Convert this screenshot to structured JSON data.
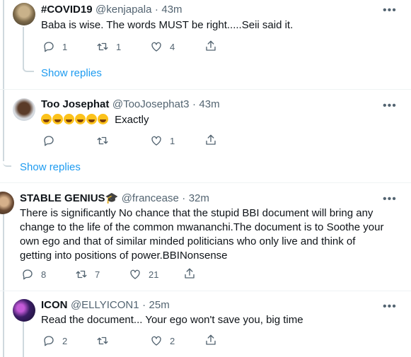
{
  "tweets": [
    {
      "name": "#COVID19",
      "handle": "@kenjapala",
      "time": "43m",
      "text": "Baba is wise. The words MUST be right.....Seii said it.",
      "replies": "1",
      "retweets": "1",
      "likes": "4",
      "show_replies": "Show replies"
    },
    {
      "name": "Too Josephat",
      "handle": "@TooJosephat3",
      "time": "43m",
      "emoji": "🤣🤣🤣🤣🤣🤣",
      "text": "Exactly",
      "replies": "",
      "retweets": "",
      "likes": "1"
    },
    {
      "show_replies": "Show replies"
    },
    {
      "name": "STABLE GENIUS🎓",
      "handle": "@francease",
      "time": "32m",
      "text_lines": [
        "There is significantly No chance that the stupid BBI document will bring any",
        "change to the life of the common mwananchi.The document is to Soothe your",
        "own ego and that of similar minded politicians who only live and think of",
        "getting into positions of power.BBINonsense"
      ],
      "replies": "8",
      "retweets": "7",
      "likes": "21"
    },
    {
      "name": "ICON",
      "handle": "@ELLYICON1",
      "time": "25m",
      "text": "Read the document... Your ego won't save you, big time",
      "replies": "2",
      "retweets": "",
      "likes": "2"
    }
  ],
  "separator": "·",
  "more_glyph": "•••",
  "icons": [
    "reply-icon",
    "retweet-icon",
    "like-icon",
    "share-icon",
    "more-icon"
  ],
  "colors": {
    "link": "#1d9bf0",
    "muted": "#536471",
    "line": "#cfd9de"
  }
}
